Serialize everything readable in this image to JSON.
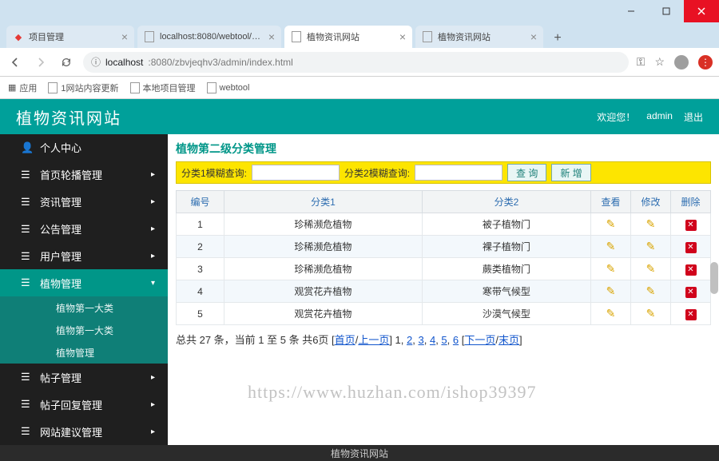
{
  "browser": {
    "tabs": [
      {
        "title": "项目管理",
        "active": false
      },
      {
        "title": "localhost:8080/webtool/all/in",
        "active": false
      },
      {
        "title": "植物资讯网站",
        "active": true
      },
      {
        "title": "植物资讯网站",
        "active": false
      }
    ],
    "url_host": "localhost",
    "url_rest": ":8080/zbvjeqhv3/admin/index.html",
    "bookmarks": [
      {
        "label": "应用",
        "icon": "apps"
      },
      {
        "label": "1网站内容更新",
        "icon": "doc"
      },
      {
        "label": "本地项目管理",
        "icon": "doc"
      },
      {
        "label": "webtool",
        "icon": "doc"
      }
    ]
  },
  "header": {
    "title": "植物资讯网站",
    "welcome": "欢迎您！",
    "user": "admin",
    "logout": "退出"
  },
  "sidebar": {
    "items": [
      {
        "label": "个人中心"
      },
      {
        "label": "首页轮播管理"
      },
      {
        "label": "资讯管理"
      },
      {
        "label": "公告管理"
      },
      {
        "label": "用户管理"
      },
      {
        "label": "植物管理",
        "active": true
      },
      {
        "label": "帖子管理"
      },
      {
        "label": "帖子回复管理"
      },
      {
        "label": "网站建议管理"
      }
    ],
    "sub_items": [
      {
        "label": "植物第一大类"
      },
      {
        "label": "植物第一大类"
      },
      {
        "label": "植物管理"
      }
    ]
  },
  "content": {
    "panel_title": "植物第二级分类管理",
    "filter": {
      "label1": "分类1模糊查询:",
      "label2": "分类2模糊查询:",
      "search_btn": "查 询",
      "add_btn": "新 增"
    },
    "columns": {
      "c1": "编号",
      "c2": "分类1",
      "c3": "分类2",
      "c4": "查看",
      "c5": "修改",
      "c6": "删除"
    },
    "rows": [
      {
        "id": "1",
        "cat1": "珍稀濒危植物",
        "cat2": "被子植物门"
      },
      {
        "id": "2",
        "cat1": "珍稀濒危植物",
        "cat2": "裸子植物门"
      },
      {
        "id": "3",
        "cat1": "珍稀濒危植物",
        "cat2": "蕨类植物门"
      },
      {
        "id": "4",
        "cat1": "观赏花卉植物",
        "cat2": "寒带气候型"
      },
      {
        "id": "5",
        "cat1": "观赏花卉植物",
        "cat2": "沙漠气候型"
      }
    ],
    "pager": {
      "summary_pre": "总共 27 条，当前 1 至 5 条 共6页  [",
      "first": "首页",
      "prev": "上一页",
      "mid": "] 1, ",
      "p2": "2",
      "p3": "3",
      "p4": "4",
      "p5": "5",
      "p6": "6",
      "next_open": " [",
      "next": "下一页",
      "last": "末页",
      "close": "]"
    }
  },
  "footer": {
    "text": "植物资讯网站"
  },
  "watermark": "https://www.huzhan.com/ishop39397"
}
